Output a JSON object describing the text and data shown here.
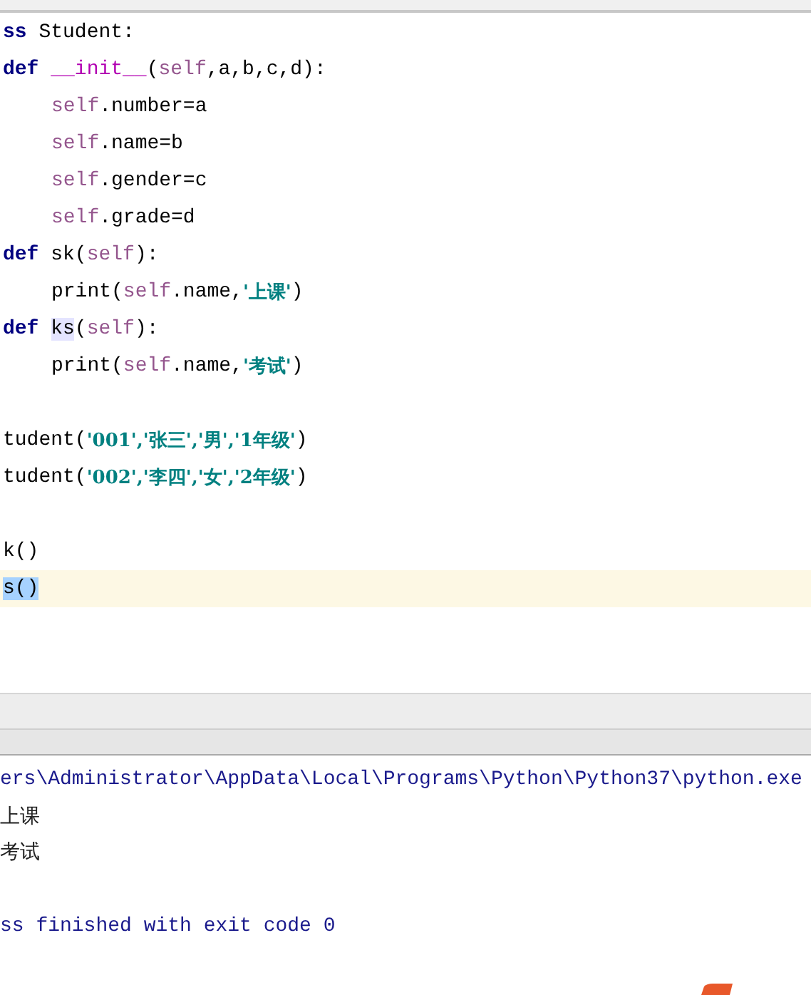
{
  "editor": {
    "lines": [
      {
        "current": false,
        "tokens": [
          {
            "kind": "keyword",
            "text": "ss"
          },
          {
            "kind": "plain",
            "text": " Student:"
          }
        ]
      },
      {
        "current": false,
        "tokens": [
          {
            "kind": "keyword",
            "text": "def "
          },
          {
            "kind": "magic",
            "text": "__init__"
          },
          {
            "kind": "plain",
            "text": "("
          },
          {
            "kind": "self",
            "text": "self"
          },
          {
            "kind": "plain",
            "text": ",a,b,c,d):"
          }
        ]
      },
      {
        "current": false,
        "indent": true,
        "tokens": [
          {
            "kind": "self",
            "text": "self"
          },
          {
            "kind": "plain",
            "text": ".number=a"
          }
        ]
      },
      {
        "current": false,
        "indent": true,
        "tokens": [
          {
            "kind": "self",
            "text": "self"
          },
          {
            "kind": "plain",
            "text": ".name=b"
          }
        ]
      },
      {
        "current": false,
        "indent": true,
        "tokens": [
          {
            "kind": "self",
            "text": "self"
          },
          {
            "kind": "plain",
            "text": ".gender=c"
          }
        ]
      },
      {
        "current": false,
        "indent": true,
        "tokens": [
          {
            "kind": "self",
            "text": "self"
          },
          {
            "kind": "plain",
            "text": ".grade=d"
          }
        ]
      },
      {
        "current": false,
        "tokens": [
          {
            "kind": "keyword",
            "text": "def"
          },
          {
            "kind": "plain",
            "text": " sk("
          },
          {
            "kind": "self",
            "text": "self"
          },
          {
            "kind": "plain",
            "text": "):"
          }
        ]
      },
      {
        "current": false,
        "indent": true,
        "tokens": [
          {
            "kind": "plain",
            "text": "print("
          },
          {
            "kind": "self",
            "text": "self"
          },
          {
            "kind": "plain",
            "text": ".name,"
          },
          {
            "kind": "string",
            "text": "'上课'"
          },
          {
            "kind": "plain",
            "text": ")"
          }
        ]
      },
      {
        "current": false,
        "tokens": [
          {
            "kind": "keyword",
            "text": "def "
          },
          {
            "kind": "plain",
            "text": "ks",
            "highlighted": true
          },
          {
            "kind": "plain",
            "text": "("
          },
          {
            "kind": "self",
            "text": "self"
          },
          {
            "kind": "plain",
            "text": "):"
          }
        ]
      },
      {
        "current": false,
        "indent": true,
        "tokens": [
          {
            "kind": "plain",
            "text": "print("
          },
          {
            "kind": "self",
            "text": "self"
          },
          {
            "kind": "plain",
            "text": ".name,"
          },
          {
            "kind": "string",
            "text": "'考试'"
          },
          {
            "kind": "plain",
            "text": ")"
          }
        ]
      },
      {
        "current": false
      },
      {
        "current": false,
        "tokens": [
          {
            "kind": "plain",
            "text": "tudent("
          },
          {
            "kind": "string",
            "text": "'001','张三','男','1年级'"
          },
          {
            "kind": "plain",
            "text": ")"
          }
        ]
      },
      {
        "current": false,
        "tokens": [
          {
            "kind": "plain",
            "text": "tudent("
          },
          {
            "kind": "string",
            "text": "'002','李四','女','2年级'"
          },
          {
            "kind": "plain",
            "text": ")"
          }
        ]
      },
      {
        "current": false
      },
      {
        "current": false,
        "tokens": [
          {
            "kind": "plain",
            "text": "k()"
          }
        ]
      },
      {
        "current": true,
        "tokens": [
          {
            "kind": "plain",
            "text": "s()",
            "selected": true
          }
        ]
      }
    ]
  },
  "console": {
    "lines": [
      {
        "kind": "system",
        "text": "ers\\Administrator\\AppData\\Local\\Programs\\Python\\Python37\\python.exe"
      },
      {
        "kind": "output",
        "text": "上课"
      },
      {
        "kind": "output",
        "text": "考试"
      },
      {
        "kind": "blank"
      },
      {
        "kind": "system",
        "text": "ss finished with exit code 0"
      }
    ]
  }
}
